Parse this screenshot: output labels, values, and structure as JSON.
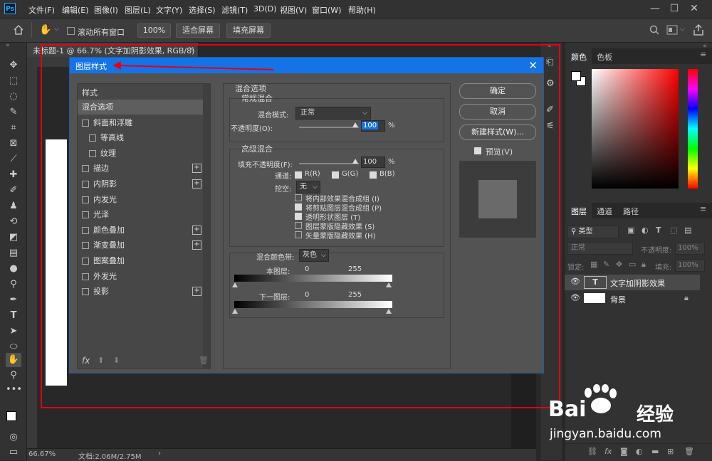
{
  "menubar": {
    "logo": "Ps",
    "items": [
      "文件(F)",
      "编辑(E)",
      "图像(I)",
      "图层(L)",
      "文字(Y)",
      "选择(S)",
      "滤镜(T)",
      "3D(D)",
      "视图(V)",
      "窗口(W)",
      "帮助(H)"
    ],
    "window_controls": [
      "—",
      "☐",
      "✕"
    ]
  },
  "optbar": {
    "scroll_all_label": "滚动所有窗口",
    "zoom_value": "100%",
    "fit_screen": "适合屏幕",
    "fill_screen": "填充屏幕"
  },
  "document": {
    "tab_title": "未标题-1 @ 66.7% (文字加阴影效果, RGB/8) *",
    "tab_close": "×",
    "status_zoom": "66.67%",
    "status_doc": "文档:2.06M/2.75M",
    "status_arrow": "›"
  },
  "dialog": {
    "title": "图层样式",
    "close": "✕",
    "styles_header": "样式",
    "style_items": [
      {
        "label": "混合选项",
        "checkbox": false,
        "plus": false,
        "selected": true,
        "indent": false
      },
      {
        "label": "斜面和浮雕",
        "checkbox": true,
        "plus": false,
        "selected": false,
        "indent": false
      },
      {
        "label": "等高线",
        "checkbox": true,
        "plus": false,
        "selected": false,
        "indent": true
      },
      {
        "label": "纹理",
        "checkbox": true,
        "plus": false,
        "selected": false,
        "indent": true
      },
      {
        "label": "描边",
        "checkbox": true,
        "plus": true,
        "selected": false,
        "indent": false
      },
      {
        "label": "内阴影",
        "checkbox": true,
        "plus": true,
        "selected": false,
        "indent": false
      },
      {
        "label": "内发光",
        "checkbox": true,
        "plus": false,
        "selected": false,
        "indent": false
      },
      {
        "label": "光泽",
        "checkbox": true,
        "plus": false,
        "selected": false,
        "indent": false
      },
      {
        "label": "颜色叠加",
        "checkbox": true,
        "plus": true,
        "selected": false,
        "indent": false
      },
      {
        "label": "渐变叠加",
        "checkbox": true,
        "plus": true,
        "selected": false,
        "indent": false
      },
      {
        "label": "图案叠加",
        "checkbox": true,
        "plus": false,
        "selected": false,
        "indent": false
      },
      {
        "label": "外发光",
        "checkbox": true,
        "plus": false,
        "selected": false,
        "indent": false
      },
      {
        "label": "投影",
        "checkbox": true,
        "plus": true,
        "selected": false,
        "indent": false
      }
    ],
    "fx_label": "fx",
    "blend_options_title": "混合选项",
    "general_blend_title": "常规混合",
    "blend_mode_label": "混合模式:",
    "blend_mode_value": "正常",
    "opacity_label": "不透明度(O):",
    "opacity_value": "100",
    "percent": "%",
    "advanced_blend_title": "高级混合",
    "fill_opacity_label": "填充不透明度(F):",
    "fill_opacity_value": "100",
    "channels_label": "通道:",
    "channel_r": "R(R)",
    "channel_g": "G(G)",
    "channel_b": "B(B)",
    "knockout_label": "挖空:",
    "knockout_value": "无",
    "opt1": "将内部效果混合成组 (I)",
    "opt2": "将剪贴图层混合成组 (P)",
    "opt3": "透明形状图层 (T)",
    "opt4": "图层蒙版隐藏效果 (S)",
    "opt5": "矢量蒙版隐藏效果 (H)",
    "blend_if_label": "混合颜色带:",
    "blend_if_value": "灰色",
    "this_layer_label": "本图层:",
    "underlying_label": "下一图层:",
    "range_min": "0",
    "range_max": "255",
    "ok": "确定",
    "cancel": "取消",
    "new_style": "新建样式(W)...",
    "preview_label": "预览(V)"
  },
  "rightpanel": {
    "tab_color": "颜色",
    "tab_swatches": "色板",
    "tab_layers": "图层",
    "tab_channels": "通道",
    "tab_paths": "路径",
    "filter_kind": "类型",
    "blend_mode": "正常",
    "opacity_label": "不透明度:",
    "opacity_value": "100%",
    "lock_label": "锁定:",
    "fill_label": "填充:",
    "fill_value": "100%",
    "layers": [
      {
        "name": "文字加阴影效果",
        "type": "text",
        "thumb": "T"
      },
      {
        "name": "背景",
        "type": "background",
        "thumb": ""
      }
    ]
  },
  "watermark": {
    "brand": "Bai",
    "brand2": "经验",
    "url": "jingyan.baidu.com"
  }
}
